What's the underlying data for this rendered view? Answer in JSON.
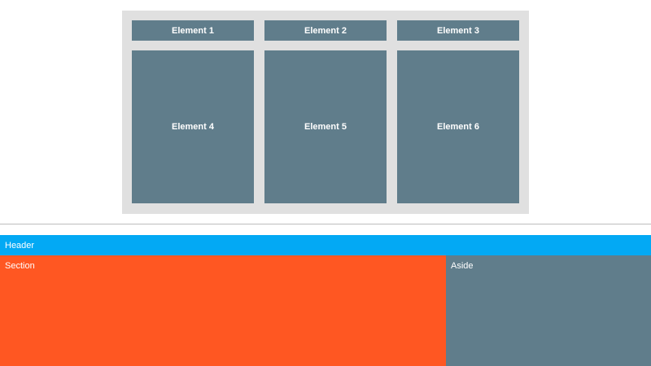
{
  "grid": {
    "elements": [
      {
        "label": "Element 1"
      },
      {
        "label": "Element 2"
      },
      {
        "label": "Element 3"
      },
      {
        "label": "Element 4"
      },
      {
        "label": "Element 5"
      },
      {
        "label": "Element 6"
      }
    ]
  },
  "layout_demo": {
    "header_label": "Header",
    "section_label": "Section",
    "aside_label": "Aside"
  },
  "colors": {
    "grid_background": "#e0e0e0",
    "element": "#607d8b",
    "header": "#03a9f4",
    "section": "#ff5722",
    "aside": "#607d8b",
    "text": "#ffffff"
  }
}
